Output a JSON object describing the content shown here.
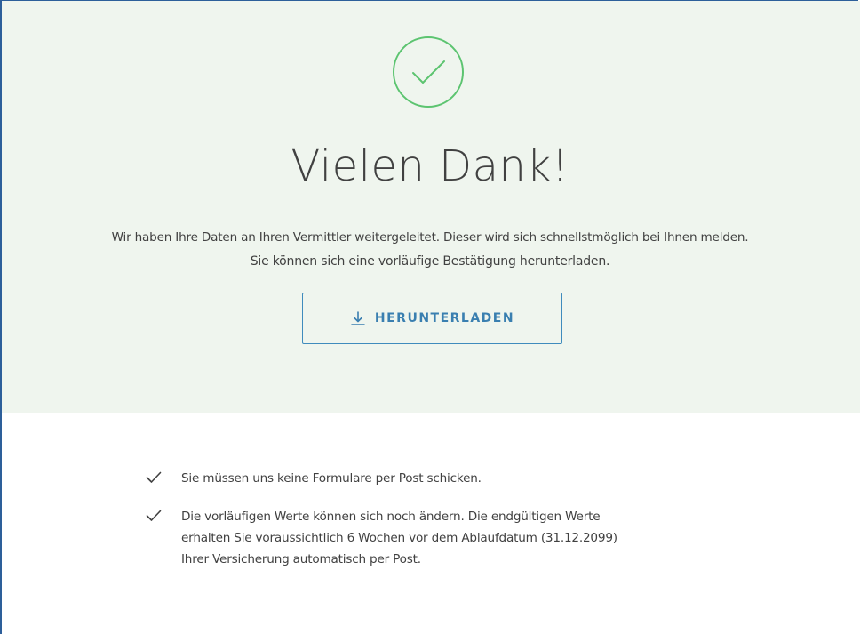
{
  "confirmation": {
    "title": "Vielen Dank!",
    "message_line1": "Wir haben Ihre Daten an Ihren Vermittler weitergeleitet. Dieser wird sich schnellstmöglich bei Ihnen melden.",
    "message_line2": "Sie können sich eine vorläufige Bestätigung herunterladen.",
    "download_label": "HERUNTERLADEN",
    "icons": {
      "success": "check-circle-icon",
      "download": "download-icon",
      "list_bullet": "checkmark-icon"
    },
    "colors": {
      "hero_background": "#eff5ee",
      "success_green": "#5cc470",
      "button_blue": "#3a7fb0",
      "text": "#414141"
    }
  },
  "info_list": {
    "items": [
      {
        "text": "Sie müssen uns keine Formulare per Post schicken."
      },
      {
        "line1": "Die vorläufigen Werte können sich noch ändern. Die endgültigen Werte",
        "line2": "erhalten Sie voraussichtlich 6 Wochen vor dem Ablaufdatum (31.12.2099)",
        "line3": "Ihrer Versicherung automatisch per Post."
      }
    ]
  }
}
